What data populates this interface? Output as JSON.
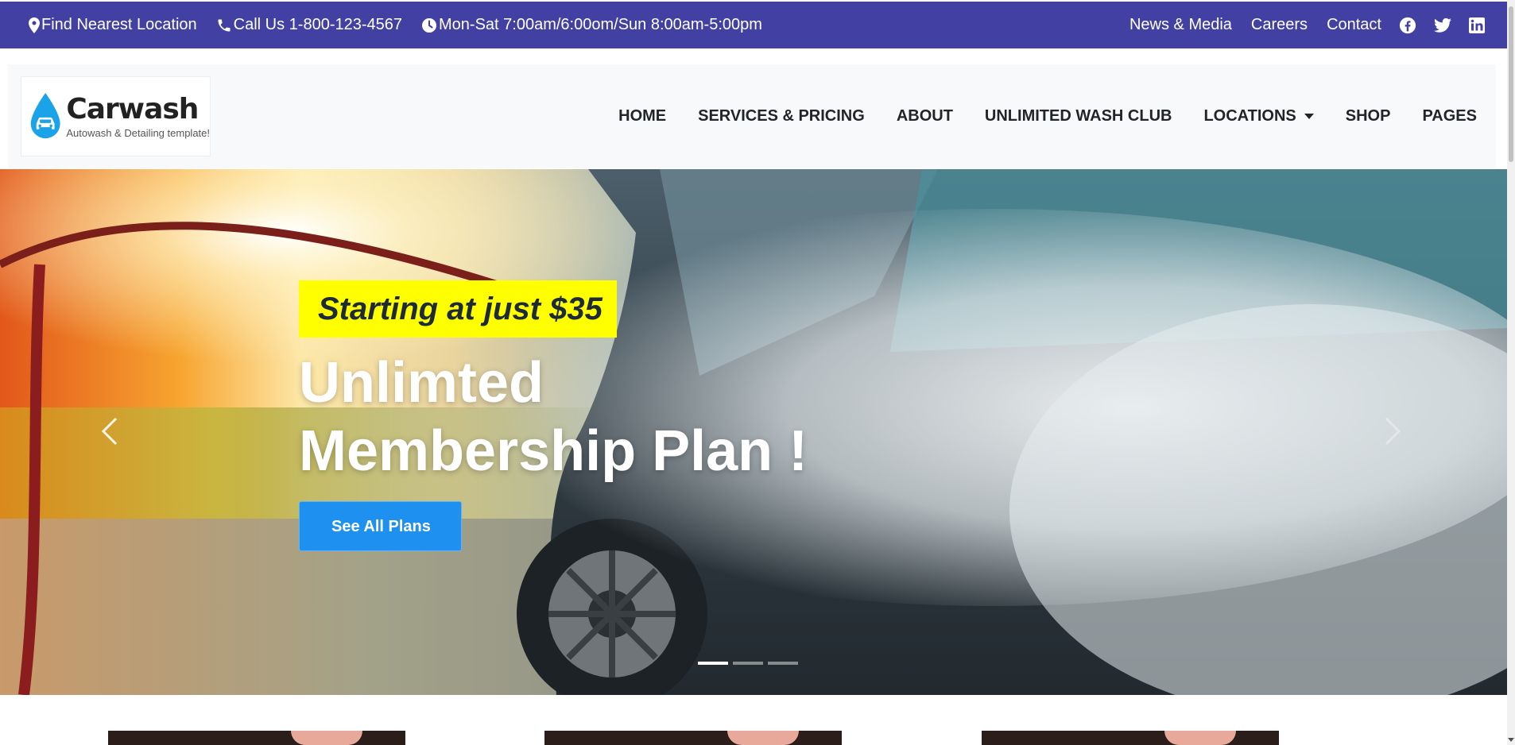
{
  "topbar": {
    "location": "Find Nearest Location",
    "phone": "Call Us 1-800-123-4567",
    "hours": "Mon-Sat 7:00am/6:00om/Sun 8:00am-5:00pm",
    "links": [
      "News & Media",
      "Careers",
      "Contact"
    ],
    "social_icons": [
      "facebook-icon",
      "twitter-icon",
      "linkedin-icon"
    ],
    "background_color": "#4240a3"
  },
  "brand": {
    "name": "Carwash",
    "tagline": "Autowash & Detailing template!",
    "logo_icon": "water-drop-car-icon",
    "logo_color": "#1aa3e8"
  },
  "nav": {
    "items": [
      "HOME",
      "SERVICES & PRICING",
      "ABOUT",
      "UNLIMITED WASH CLUB",
      "LOCATIONS",
      "SHOP",
      "PAGES"
    ]
  },
  "hero": {
    "badge": "Starting at just $35",
    "headline": "Unlimted Membership Plan !",
    "cta_label": "See All Plans",
    "badge_color": "#ffff00",
    "cta_color": "#1e90f0",
    "slide_count": 3,
    "active_slide": 1
  }
}
